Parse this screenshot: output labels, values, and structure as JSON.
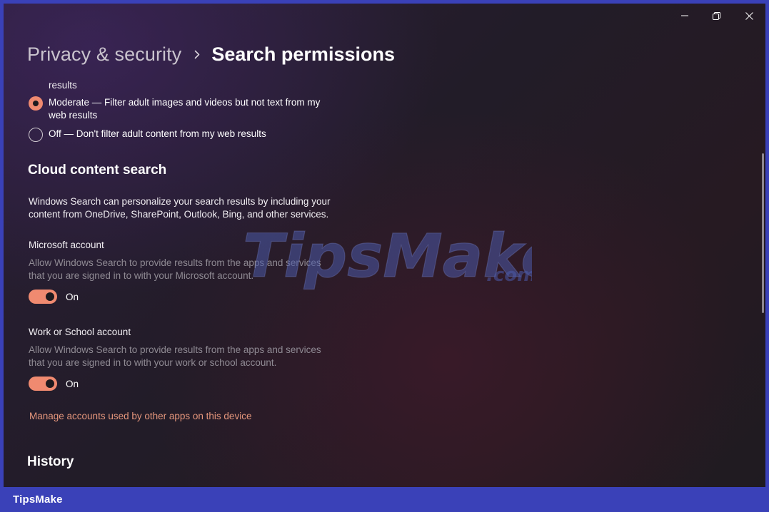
{
  "window": {
    "minimize_icon": "minimize-icon",
    "maximize_icon": "restore-icon",
    "close_icon": "close-icon"
  },
  "breadcrumb": {
    "parent": "Privacy & security",
    "separator_icon": "chevron-right-icon",
    "current": "Search permissions"
  },
  "safesearch": {
    "strict_tail": "results",
    "options": [
      {
        "line1": "Moderate — Filter adult images and videos but not text from my",
        "line2": "web results",
        "selected": true
      },
      {
        "line1": "Off — Don't filter adult content from my web results",
        "selected": false
      }
    ]
  },
  "cloud": {
    "title": "Cloud content search",
    "description_line1": "Windows Search can personalize your search results by including your",
    "description_line2": "content from OneDrive, SharePoint, Outlook, Bing, and other services.",
    "microsoft_account": {
      "title": "Microsoft account",
      "desc_line1": "Allow Windows Search to provide results from the apps and services",
      "desc_line2": "that you are signed in to with your Microsoft account.",
      "toggle_state": "On"
    },
    "work_account": {
      "title": "Work or School account",
      "desc_line1": "Allow Windows Search to provide results from the apps and services",
      "desc_line2": "that you are signed in to with your work or school account.",
      "toggle_state": "On"
    },
    "manage_link": "Manage accounts used by other apps on this device"
  },
  "history": {
    "title": "History"
  },
  "watermark": {
    "text": "TipsMake",
    "suffix": ".com"
  },
  "footer": {
    "brand": "TipsMake"
  },
  "colors": {
    "accent": "#f08a70",
    "link": "#e5967c",
    "frame_border": "#3a41b8"
  }
}
